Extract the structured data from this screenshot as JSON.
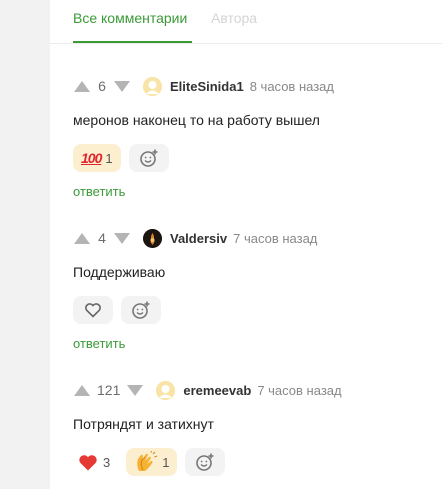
{
  "tabs": [
    {
      "label": "Все комментарии",
      "active": true
    },
    {
      "label": "Автора",
      "active": false
    }
  ],
  "colors": {
    "accent": "#3b9a37",
    "inactive_tab": "#d4d4d4",
    "heart": "#e53935"
  },
  "comments": [
    {
      "score": "6",
      "author": "EliteSinida1",
      "time": "8 часов назад",
      "text": "меронов наконец то на работу вышел",
      "reactions": [
        {
          "icon": "hundred-points-icon",
          "glyph": "100",
          "count": "1"
        }
      ],
      "reply_label": "ответить"
    },
    {
      "score": "4",
      "author": "Valdersiv",
      "time": "7 часов назад",
      "text": "Поддерживаю",
      "reactions": [],
      "reply_label": "ответить"
    },
    {
      "score": "121",
      "author": "eremeevab",
      "time": "7 часов назад",
      "text": "Потряндят и затихнут",
      "reactions": [
        {
          "icon": "heart-icon",
          "count": "3"
        },
        {
          "icon": "clapping-hands-icon",
          "count": "1"
        }
      ]
    }
  ]
}
